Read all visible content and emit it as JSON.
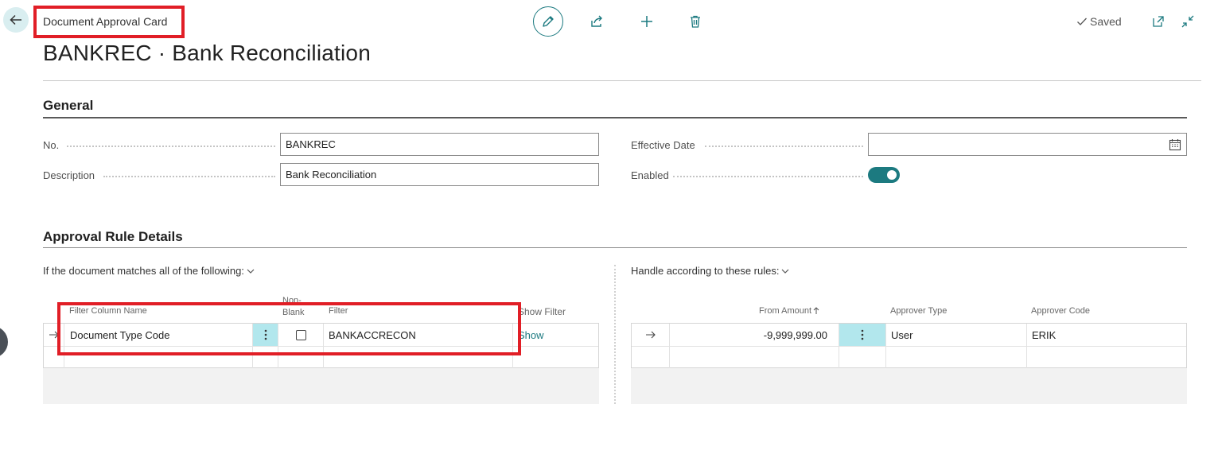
{
  "header": {
    "breadcrumb": "Document Approval Card",
    "title": "BANKREC · Bank Reconciliation",
    "saved_label": "Saved"
  },
  "toolbar": {
    "icons": [
      "back-arrow-icon",
      "pencil-icon",
      "share-icon",
      "plus-icon",
      "trash-icon",
      "checkmark-icon",
      "open-in-new-window-icon",
      "collapse-icon"
    ]
  },
  "general": {
    "title": "General",
    "fields": {
      "no_label": "No.",
      "no_value": "BANKREC",
      "description_label": "Description",
      "description_value": "Bank Reconciliation",
      "effective_date_label": "Effective Date",
      "effective_date_value": "",
      "enabled_label": "Enabled",
      "enabled_value": true
    }
  },
  "approval_rules": {
    "title": "Approval Rule Details",
    "filters_caption": "If the document matches all of the following:",
    "filters_columns": {
      "filter_column_name": "Filter Column Name",
      "non_blank_line1": "Non-",
      "non_blank_line2": "Blank",
      "filter": "Filter",
      "show_filter": "Show Filter"
    },
    "filters_rows": [
      {
        "filter_column_name": "Document Type Code",
        "non_blank": false,
        "filter": "BANKACCRECON",
        "show_filter": "Show"
      }
    ],
    "rules_caption": "Handle according to these rules:",
    "rules_columns": {
      "from_amount": "From Amount",
      "approver_type": "Approver Type",
      "approver_code": "Approver Code"
    },
    "rules_rows": [
      {
        "from_amount": "-9,999,999.00",
        "approver_type": "User",
        "approver_code": "ERIK"
      }
    ]
  },
  "colors": {
    "accent": "#1c7a80",
    "highlight": "#e11e26",
    "ellipsis_cell": "#b2e7ed"
  }
}
